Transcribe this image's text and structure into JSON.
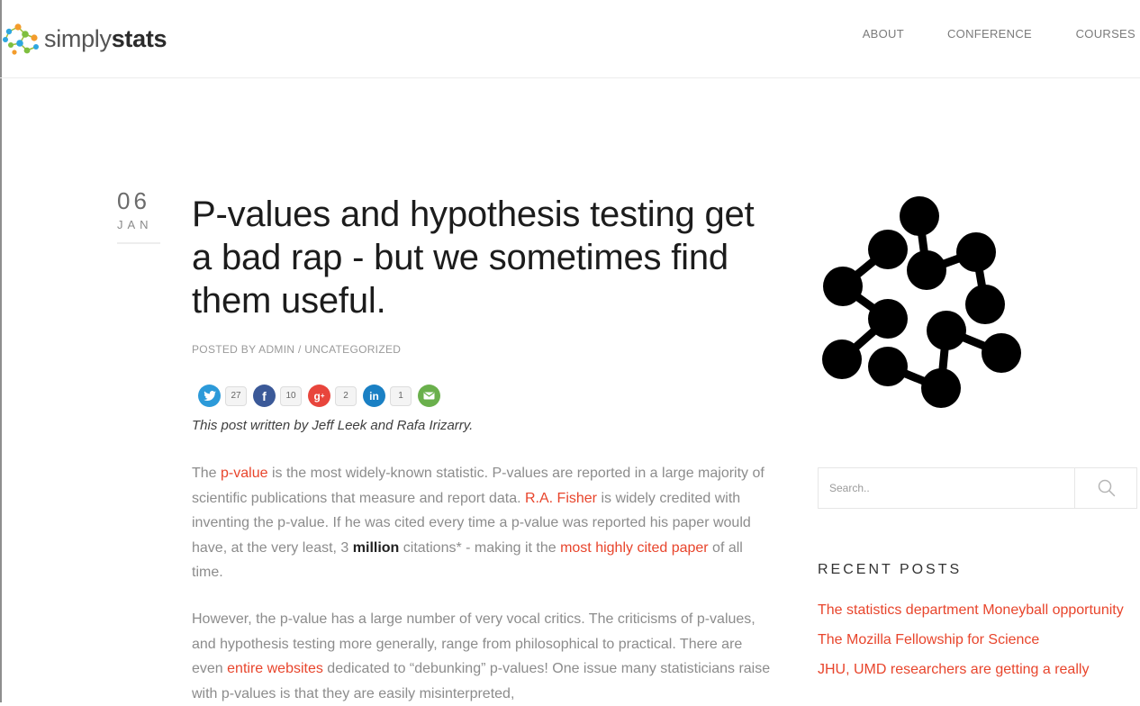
{
  "brand": {
    "part1": "simply",
    "part2": "stats"
  },
  "nav": [
    {
      "label": "ABOUT"
    },
    {
      "label": "CONFERENCE"
    },
    {
      "label": "COURSES"
    }
  ],
  "post": {
    "day": "06",
    "month": "JAN",
    "title": "P-values and hypothesis testing get a bad rap - but we sometimes find them useful.",
    "meta": "POSTED BY ADMIN / UNCATEGORIZED",
    "share": {
      "twitter_count": "27",
      "facebook_count": "10",
      "googleplus_count": "2",
      "linkedin_count": "1"
    },
    "byline": "This post written by Jeff Leek and Rafa Irizarry.",
    "p1": {
      "t1": "The ",
      "link1": "p-value",
      "t2": " is the most widely-known statistic. P-values are reported in a large majority of scientific publications that measure and report data. ",
      "link2": "R.A. Fisher",
      "t3": " is widely credited with inventing the p-value. If he was cited every time a p-value was reported his paper would have, at the very least, 3 ",
      "bold": "million",
      "t4": " citations* - making it the ",
      "link3": "most highly cited paper",
      "t5": " of all time."
    },
    "p2": {
      "t1": "However, the p-value has a large number of very vocal critics. The criticisms of p-values, and hypothesis testing more generally, range from philosophical to practical. There are even ",
      "link1": "entire websites",
      "t2": " dedicated to “debunking” p-values! One issue many statisticians raise with p-values is that they are easily misinterpreted,"
    }
  },
  "sidebar": {
    "search_placeholder": "Search..",
    "recent_title": "RECENT POSTS",
    "recent_posts": [
      "The statistics department Moneyball opportunity",
      "The Mozilla Fellowship for Science",
      "JHU, UMD researchers are getting a really"
    ]
  },
  "colors": {
    "accent": "#e8452c",
    "twitter": "#2c9ad9",
    "facebook": "#3b5998",
    "googleplus": "#e8453c",
    "linkedin": "#1a80c4",
    "email": "#6ab04c"
  },
  "icons": [
    "simplystats-logo-icon",
    "twitter-icon",
    "facebook-icon",
    "googleplus-icon",
    "linkedin-icon",
    "email-icon",
    "molecule-logo-icon",
    "search-icon"
  ]
}
